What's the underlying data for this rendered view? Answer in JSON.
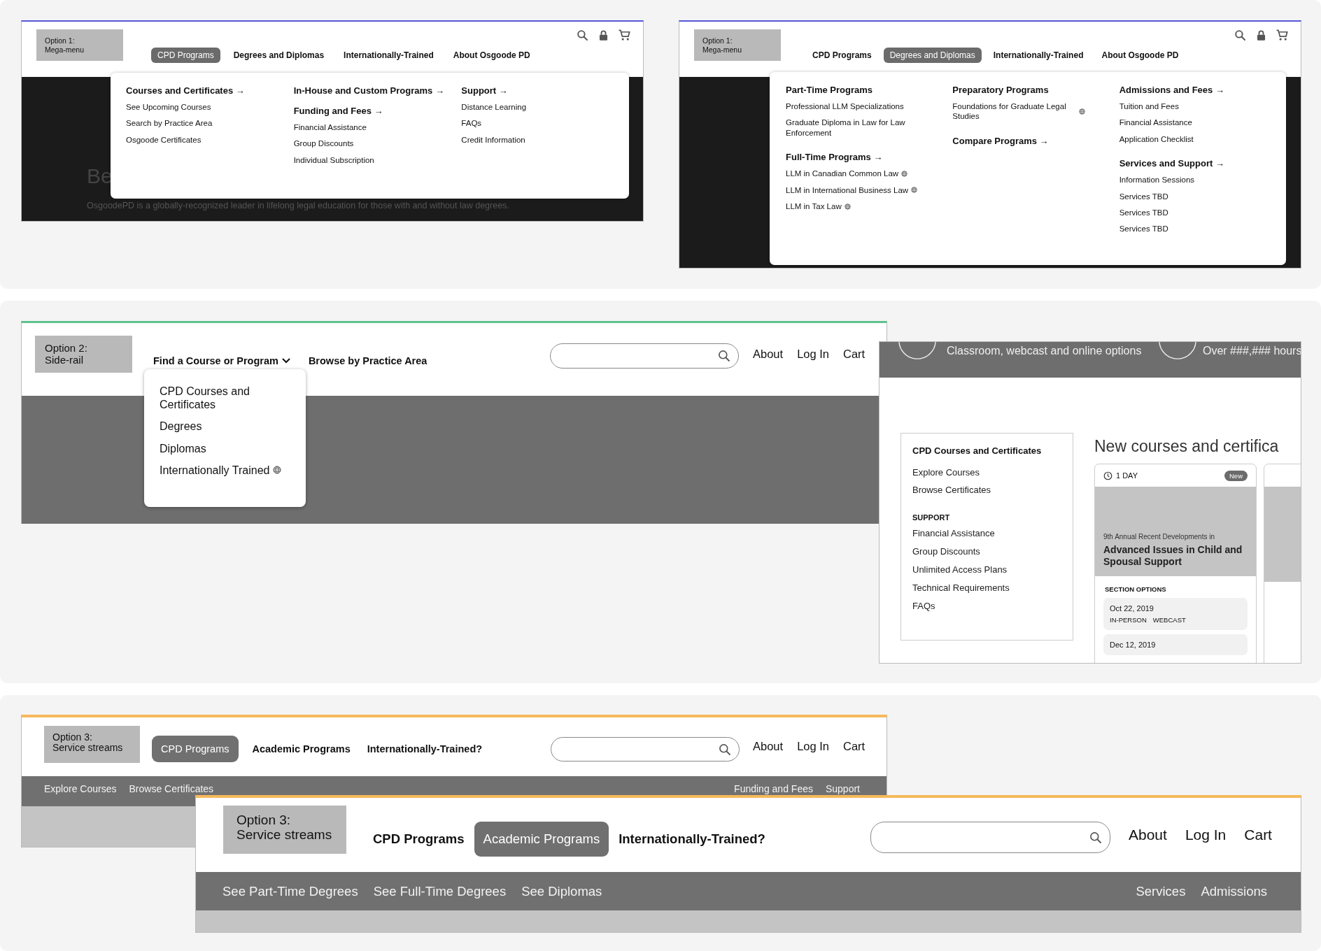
{
  "mega_panels": [
    {
      "label": "Option 1:\nMega-menu",
      "tabs": [
        {
          "label": "CPD Programs",
          "selected": true
        },
        {
          "label": "Degrees and Diplomas",
          "selected": false
        },
        {
          "label": "Internationally-Trained",
          "selected": false
        },
        {
          "label": "About Osgoode PD",
          "selected": false
        }
      ],
      "hero": {
        "heading": "Be",
        "text": "OsgoodePD is a globally-recognized leader in lifelong legal education for those with and without law degrees."
      },
      "columns": [
        [
          {
            "heading": "Courses and Certificates →",
            "items": [
              {
                "label": "See Upcoming Courses",
                "globe": false
              },
              {
                "label": "Search by Practice Area",
                "globe": false
              },
              {
                "label": "Osgoode Certificates",
                "globe": false
              }
            ]
          }
        ],
        [
          {
            "heading": "In-House and Custom Programs →"
          },
          {
            "heading": "Funding and Fees →",
            "items": [
              {
                "label": "Financial Assistance",
                "globe": false
              },
              {
                "label": "Group Discounts",
                "globe": false
              },
              {
                "label": "Individual Subscription",
                "globe": false
              }
            ]
          }
        ],
        [
          {
            "heading": "Support →",
            "items": [
              {
                "label": "Distance Learning",
                "globe": false
              },
              {
                "label": "FAQs",
                "globe": false
              },
              {
                "label": "Credit Information",
                "globe": false
              }
            ]
          }
        ]
      ]
    },
    {
      "label": "Option 1:\nMega-menu",
      "tabs": [
        {
          "label": "CPD Programs",
          "selected": false
        },
        {
          "label": "Degrees and Diplomas",
          "selected": true
        },
        {
          "label": "Internationally-Trained",
          "selected": false
        },
        {
          "label": "About Osgoode PD",
          "selected": false
        }
      ],
      "columns": [
        [
          {
            "heading": "Part-Time Programs",
            "items": [
              {
                "label": "Professional LLM Specializations",
                "globe": false
              },
              {
                "label": "Graduate Diploma in Law for Law Enforcement",
                "globe": false
              }
            ]
          },
          {
            "heading": "Full-Time Programs →",
            "items": [
              {
                "label": "LLM in Canadian Common Law",
                "globe": true
              },
              {
                "label": "LLM in International Business Law",
                "globe": true
              },
              {
                "label": "LLM in Tax Law",
                "globe": true
              }
            ]
          }
        ],
        [
          {
            "heading": "Preparatory Programs",
            "items": [
              {
                "label": "Foundations for Graduate Legal Studies",
                "globe": true
              }
            ]
          },
          {
            "heading": "Compare Programs →"
          }
        ],
        [
          {
            "heading": "Admissions and Fees →",
            "items": [
              {
                "label": "Tuition and Fees",
                "globe": false
              },
              {
                "label": "Financial Assistance",
                "globe": false
              },
              {
                "label": "Application Checklist",
                "globe": false
              }
            ]
          },
          {
            "heading": "Services and Support →",
            "items": [
              {
                "label": "Information Sessions",
                "globe": false
              },
              {
                "label": "Services TBD",
                "globe": false
              },
              {
                "label": "Services TBD",
                "globe": false
              },
              {
                "label": "Services TBD",
                "globe": false
              }
            ]
          }
        ]
      ]
    }
  ],
  "side_rail": {
    "label": "Option 2:\nSide-rail",
    "nav": [
      {
        "label": "Find a Course or Program",
        "kind": "dropdown",
        "expanded": true
      },
      {
        "label": "Browse by Practice Area",
        "kind": "link"
      }
    ],
    "dropdown": [
      {
        "label": "CPD Courses and Certificates",
        "globe": false
      },
      {
        "label": "Degrees",
        "globe": false
      },
      {
        "label": "Diplomas",
        "globe": false
      },
      {
        "label": "Internationally Trained",
        "globe": true
      }
    ],
    "links": [
      "About",
      "Log In",
      "Cart"
    ]
  },
  "side_rail_page": {
    "banner": [
      "Classroom, webcast and online options",
      "Over ###,### hours"
    ],
    "sidebar": [
      {
        "heading": "CPD Courses and Certificates",
        "kind": "title",
        "items": [
          "Explore Courses",
          "Browse Certificates"
        ]
      },
      {
        "heading": "SUPPORT",
        "kind": "caps",
        "items": [
          "Financial Assistance",
          "Group Discounts",
          "Unlimited Access Plans",
          "Technical Requirements",
          "FAQs"
        ]
      }
    ],
    "section_title": "New courses and certifica",
    "card": {
      "duration": "1 DAY",
      "badge": "New",
      "subtitle": "9th Annual Recent Developments in",
      "title": "Advanced Issues in Child and Spousal Support",
      "options_heading": "SECTION OPTIONS",
      "options": [
        {
          "date": "Oct 22, 2019",
          "formats": [
            "IN-PERSON",
            "WEBCAST"
          ]
        },
        {
          "date": "Dec 12, 2019"
        }
      ]
    }
  },
  "service_panels": [
    {
      "label": "Option 3:\nService streams",
      "tabs": [
        {
          "label": "CPD Programs",
          "selected": true
        },
        {
          "label": "Academic Programs",
          "selected": false
        },
        {
          "label": "Internationally-Trained?",
          "selected": false
        }
      ],
      "links": [
        "About",
        "Log In",
        "Cart"
      ],
      "subnav_left": [
        "Explore Courses",
        "Browse Certificates"
      ],
      "subnav_right": [
        "Funding and Fees",
        "Support"
      ]
    },
    {
      "label": "Option 3:\nService streams",
      "tabs": [
        {
          "label": "CPD Programs",
          "selected": false
        },
        {
          "label": "Academic Programs",
          "selected": true
        },
        {
          "label": "Internationally-Trained?",
          "selected": false
        }
      ],
      "links": [
        "About",
        "Log In",
        "Cart"
      ],
      "subnav_left": [
        "See Part-Time Degrees",
        "See Full-Time Degrees",
        "See Diplomas"
      ],
      "subnav_right": [
        "Services",
        "Admissions"
      ]
    }
  ]
}
